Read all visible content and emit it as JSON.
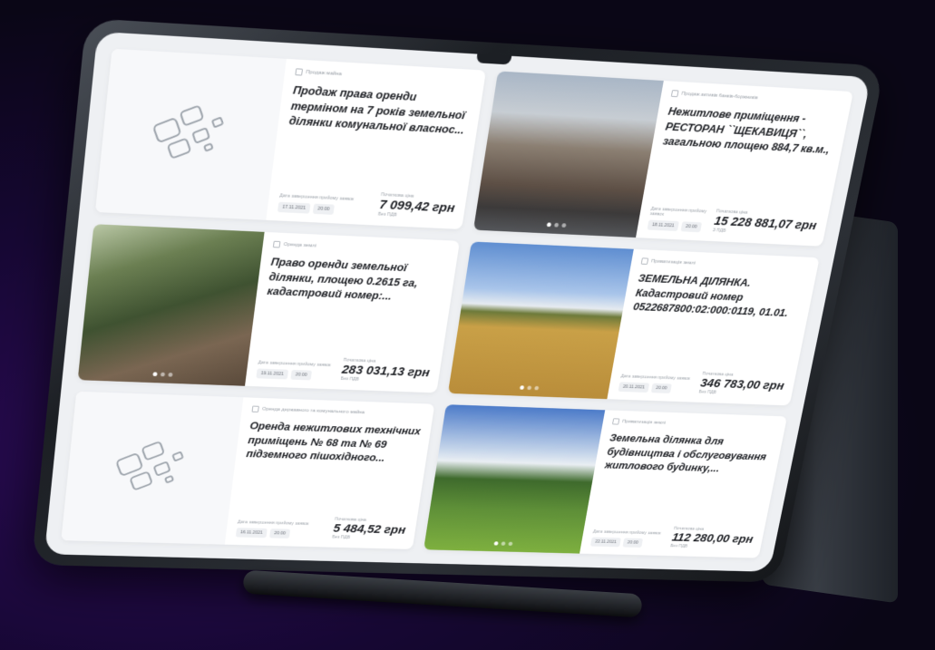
{
  "cards": [
    {
      "category": "Продаж майна",
      "title": "Продаж права оренди терміном на 7 років земельної ділянки комунальної власнос...",
      "date_label": "Дата завершення прийому заявок",
      "date": "17.11.2021",
      "time": "20:00",
      "price_label": "Початкова ціна",
      "price": "7 099,42 грн",
      "vat": "Без ПДВ",
      "image": "placeholder"
    },
    {
      "category": "Продаж активів банків-боржників",
      "title": "Нежитлове приміщення - РЕСТОРАН ``ЩЕКАВИЦЯ``, загальною площею 884,7 кв.м., ...",
      "date_label": "Дата завершення прийому заявок",
      "date": "18.11.2021",
      "time": "20:00",
      "price_label": "Початкова ціна",
      "price": "15 228 881,07 грн",
      "vat": "З ПДВ",
      "image": "building"
    },
    {
      "category": "Оренда землі",
      "title": "Право оренди земельної ділянки, площею 0.2615 га, кадастровий номер:...",
      "date_label": "Дата завершення прийому заявок",
      "date": "19.11.2021",
      "time": "20:00",
      "price_label": "Початкова ціна",
      "price": "283 031,13 грн",
      "vat": "Без ПДВ",
      "image": "forest"
    },
    {
      "category": "Приватизація землі",
      "title": "ЗЕМЕЛЬНА ДІЛЯНКА. Кадастровий номер 0522687800:02:000:0119, 01.01. -...",
      "date_label": "Дата завершення прийому заявок",
      "date": "20.11.2021",
      "time": "20:00",
      "price_label": "Початкова ціна",
      "price": "346 783,00 грн",
      "vat": "Без ПДВ",
      "image": "field"
    },
    {
      "category": "Оренда державного та комунального майна",
      "title": "Оренда нежитлових технічних приміщень № 68 та № 69 підземного пішохідного...",
      "date_label": "Дата завершення прийому заявок",
      "date": "16.11.2021",
      "time": "20:00",
      "price_label": "Початкова ціна",
      "price": "5 484,52 грн",
      "vat": "Без ПДВ",
      "image": "placeholder"
    },
    {
      "category": "Приватизація землі",
      "title": "Земельна ділянка для будівництва і обслуговування житлового будинку,...",
      "date_label": "Дата завершення прийому заявок",
      "date": "22.11.2021",
      "time": "20:00",
      "price_label": "Початкова ціна",
      "price": "112 280,00 грн",
      "vat": "Без ПДВ",
      "image": "hill"
    }
  ]
}
